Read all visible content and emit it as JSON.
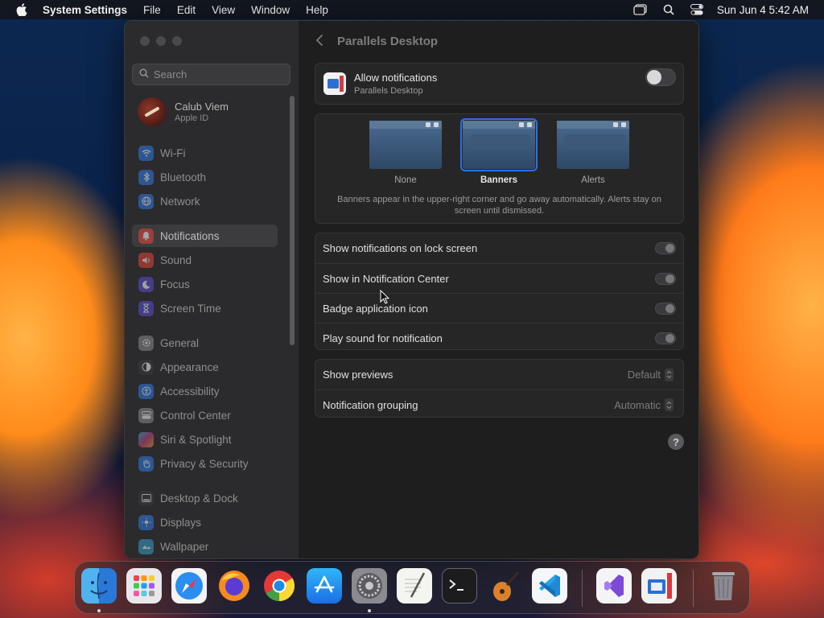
{
  "menubar": {
    "app_name": "System Settings",
    "menus": [
      "File",
      "Edit",
      "View",
      "Window",
      "Help"
    ],
    "clock": "Sun Jun 4  5:42 AM",
    "status_icons": [
      "window-icon",
      "search-icon",
      "control-center-icon"
    ]
  },
  "sidebar": {
    "search_placeholder": "Search",
    "profile": {
      "name": "Calub Viem",
      "subtitle": "Apple ID"
    },
    "items": [
      {
        "label": "Wi-Fi",
        "icon": "wifi-icon",
        "color": "#2f7be6"
      },
      {
        "label": "Bluetooth",
        "icon": "bluetooth-icon",
        "color": "#2f7be6"
      },
      {
        "label": "Network",
        "icon": "globe-icon",
        "color": "#2f7be6"
      },
      {
        "label": "Notifications",
        "icon": "bell-icon",
        "color": "#e5453a",
        "active": true
      },
      {
        "label": "Sound",
        "icon": "speaker-icon",
        "color": "#e5453a"
      },
      {
        "label": "Focus",
        "icon": "moon-icon",
        "color": "#5b4ed6"
      },
      {
        "label": "Screen Time",
        "icon": "hourglass-icon",
        "color": "#5b4ed6"
      },
      {
        "label": "General",
        "icon": "gear-icon",
        "color": "#8a8a8e"
      },
      {
        "label": "Appearance",
        "icon": "appearance-icon",
        "color": "#3a3a3c"
      },
      {
        "label": "Accessibility",
        "icon": "accessibility-icon",
        "color": "#2f7be6"
      },
      {
        "label": "Control Center",
        "icon": "control-center-icon",
        "color": "#8a8a8e"
      },
      {
        "label": "Siri & Spotlight",
        "icon": "siri-icon",
        "color": "#c2407a"
      },
      {
        "label": "Privacy & Security",
        "icon": "hand-icon",
        "color": "#2f7be6"
      },
      {
        "label": "Desktop & Dock",
        "icon": "dock-icon",
        "color": "#3a3a3c"
      },
      {
        "label": "Displays",
        "icon": "sun-icon",
        "color": "#2f7be6"
      },
      {
        "label": "Wallpaper",
        "icon": "wallpaper-icon",
        "color": "#3aa0c8"
      }
    ]
  },
  "detail": {
    "title": "Parallels Desktop",
    "allow": {
      "label": "Allow notifications",
      "app": "Parallels Desktop",
      "enabled": false
    },
    "alert_styles": [
      {
        "label": "None",
        "selected": false
      },
      {
        "label": "Banners",
        "selected": true
      },
      {
        "label": "Alerts",
        "selected": false
      }
    ],
    "style_description": "Banners appear in the upper-right corner and go away automatically. Alerts stay on screen until dismissed.",
    "toggles": [
      {
        "label": "Show notifications on lock screen",
        "enabled": false
      },
      {
        "label": "Show in Notification Center",
        "enabled": false
      },
      {
        "label": "Badge application icon",
        "enabled": false
      },
      {
        "label": "Play sound for notification",
        "enabled": false
      }
    ],
    "selects": [
      {
        "label": "Show previews",
        "value": "Default"
      },
      {
        "label": "Notification grouping",
        "value": "Automatic"
      }
    ],
    "help": "?"
  },
  "dock": {
    "apps": [
      "Finder",
      "Launchpad",
      "Safari",
      "Firefox",
      "Chrome",
      "App Store",
      "System Settings",
      "TextEdit",
      "Terminal",
      "GarageBand",
      "Visual Studio Code",
      "Visual Studio",
      "Parallels Desktop",
      "Trash"
    ],
    "running": [
      "Finder",
      "System Settings"
    ]
  }
}
